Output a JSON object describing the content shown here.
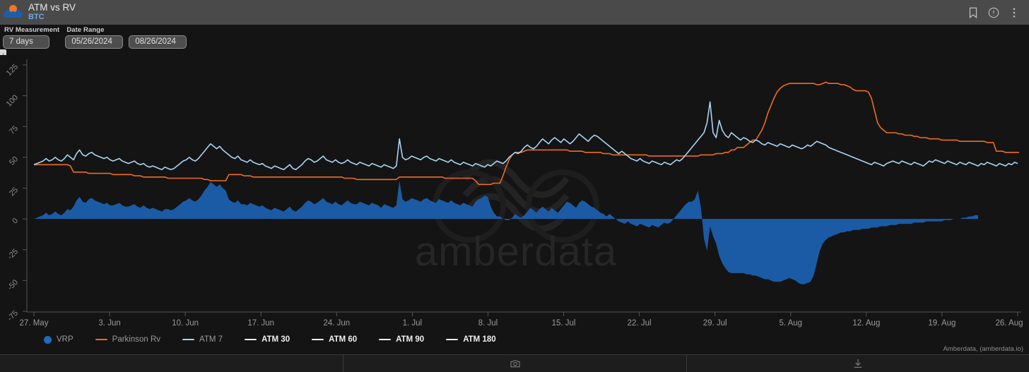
{
  "titlebar": {
    "title": "ATM vs RV",
    "subtitle": "BTC",
    "icons": {
      "bookmark": "bookmark-icon",
      "info": "info-icon",
      "more": "more-vertical-icon"
    }
  },
  "controls": {
    "rv_measurement_label": "RV Measurement",
    "rv_measurement_value": "7 days",
    "date_range_label": "Date Range",
    "date_start_value": "05/26/2024",
    "date_end_value": "08/26/2024",
    "panel_toggle_glyph": "›"
  },
  "legend": [
    {
      "label": "VRP",
      "color": "#1f6bbd",
      "marker": "dot",
      "state": "active"
    },
    {
      "label": "Parkinson Rv",
      "color": "#ef6c21",
      "marker": "line",
      "state": "active"
    },
    {
      "label": "ATM 7",
      "color": "#a8d5f2",
      "marker": "line",
      "state": "active"
    },
    {
      "label": "ATM 30",
      "color": "#f0f0f0",
      "marker": "line",
      "state": "inactive"
    },
    {
      "label": "ATM 60",
      "color": "#f0f0f0",
      "marker": "line",
      "state": "inactive"
    },
    {
      "label": "ATM 90",
      "color": "#f0f0f0",
      "marker": "line",
      "state": "inactive"
    },
    {
      "label": "ATM 180",
      "color": "#f0f0f0",
      "marker": "line",
      "state": "inactive"
    }
  ],
  "attribution": "Amberdata, (amberdata.io)",
  "watermark": "amberdata",
  "bottombar": {
    "camera_icon": "camera-icon",
    "download_icon": "download-icon"
  },
  "chart_data": {
    "type": "line",
    "title": "ATM vs RV",
    "subtitle": "BTC",
    "xlabel": "",
    "ylabel": "",
    "grid": false,
    "legend_position": "bottom-left",
    "ylim": [
      -75,
      125
    ],
    "yticks": [
      125,
      100,
      75,
      50,
      25,
      0,
      -25,
      -50,
      -75
    ],
    "xticks": [
      "27. May",
      "3. Jun",
      "10. Jun",
      "17. Jun",
      "24. Jun",
      "1. Jul",
      "8. Jul",
      "15. Jul",
      "22. Jul",
      "29. Jul",
      "5. Aug",
      "12. Aug",
      "19. Aug",
      "26. Aug"
    ],
    "x_start": "05/26/2024",
    "x_end": "08/26/2024",
    "series": [
      {
        "name": "ATM 7",
        "color": "#a8d5f2",
        "kind": "line",
        "values": [
          44,
          45,
          46,
          47,
          49,
          47,
          48,
          50,
          48,
          47,
          49,
          52,
          50,
          48,
          53,
          56,
          52,
          51,
          53,
          54,
          52,
          51,
          50,
          49,
          50,
          48,
          47,
          48,
          49,
          47,
          46,
          45,
          46,
          47,
          45,
          44,
          45,
          43,
          42,
          43,
          42,
          41,
          40,
          42,
          41,
          40,
          41,
          43,
          45,
          47,
          48,
          50,
          48,
          47,
          49,
          52,
          55,
          58,
          61,
          59,
          57,
          59,
          56,
          54,
          52,
          50,
          49,
          51,
          48,
          47,
          46,
          48,
          46,
          45,
          44,
          45,
          43,
          42,
          41,
          43,
          42,
          41,
          40,
          42,
          44,
          41,
          40,
          42,
          44,
          47,
          49,
          48,
          46,
          47,
          49,
          51,
          48,
          47,
          46,
          48,
          46,
          45,
          46,
          48,
          46,
          45,
          44,
          46,
          45,
          44,
          43,
          45,
          44,
          43,
          42,
          44,
          43,
          42,
          41,
          43,
          65,
          50,
          48,
          49,
          51,
          50,
          49,
          48,
          50,
          51,
          49,
          48,
          47,
          49,
          48,
          47,
          46,
          48,
          46,
          45,
          44,
          46,
          45,
          44,
          43,
          45,
          44,
          43,
          42,
          44,
          43,
          45,
          47,
          46,
          45,
          47,
          50,
          52,
          54,
          53,
          55,
          58,
          60,
          58,
          57,
          59,
          62,
          65,
          63,
          61,
          64,
          66,
          64,
          62,
          65,
          63,
          61,
          63,
          66,
          69,
          67,
          65,
          63,
          66,
          68,
          67,
          65,
          63,
          61,
          59,
          57,
          55,
          53,
          55,
          53,
          51,
          49,
          48,
          47,
          49,
          47,
          46,
          45,
          47,
          46,
          45,
          44,
          46,
          45,
          44,
          46,
          48,
          47,
          49,
          52,
          55,
          58,
          61,
          64,
          67,
          70,
          78,
          95,
          70,
          66,
          80,
          72,
          68,
          66,
          70,
          68,
          66,
          64,
          66,
          65,
          63,
          62,
          64,
          63,
          61,
          60,
          62,
          61,
          60,
          59,
          61,
          60,
          59,
          58,
          60,
          59,
          58,
          57,
          58,
          60,
          59,
          61,
          63,
          62,
          61,
          60,
          58,
          57,
          56,
          55,
          54,
          53,
          52,
          51,
          50,
          49,
          48,
          47,
          46,
          45,
          44,
          46,
          45,
          44,
          43,
          45,
          46,
          47,
          46,
          45,
          47,
          46,
          45,
          44,
          46,
          45,
          44,
          43,
          45,
          47,
          46,
          48,
          47,
          46,
          45,
          47,
          46,
          45,
          44,
          46,
          45,
          44,
          46,
          45,
          44,
          43,
          45,
          44,
          46,
          45,
          44,
          43,
          45,
          44,
          43,
          45,
          44,
          46,
          45
        ]
      },
      {
        "name": "Parkinson Rv",
        "color": "#ef6c21",
        "kind": "line",
        "values": [
          44,
          44,
          44,
          44,
          44,
          44,
          44,
          44,
          44,
          44,
          44,
          44,
          43,
          38,
          38,
          38,
          38,
          38,
          37,
          37,
          37,
          37,
          37,
          37,
          37,
          37,
          36,
          36,
          36,
          36,
          36,
          36,
          36,
          35,
          35,
          35,
          34,
          34,
          34,
          34,
          34,
          34,
          34,
          34,
          33,
          33,
          33,
          33,
          33,
          33,
          33,
          33,
          33,
          33,
          33,
          33,
          32,
          32,
          31,
          31,
          31,
          31,
          31,
          31,
          36,
          36,
          36,
          36,
          36,
          35,
          35,
          35,
          34,
          34,
          34,
          34,
          34,
          34,
          34,
          34,
          34,
          34,
          34,
          34,
          34,
          34,
          34,
          34,
          34,
          34,
          34,
          34,
          34,
          34,
          34,
          34,
          34,
          34,
          34,
          34,
          34,
          34,
          33,
          33,
          33,
          33,
          32,
          32,
          32,
          32,
          32,
          32,
          32,
          32,
          32,
          32,
          32,
          32,
          32,
          32,
          34,
          34,
          34,
          34,
          34,
          34,
          34,
          34,
          34,
          34,
          34,
          34,
          34,
          34,
          34,
          33,
          33,
          33,
          33,
          33,
          33,
          33,
          33,
          33,
          33,
          31,
          28,
          28,
          28,
          28,
          28,
          29,
          29,
          29,
          35,
          42,
          48,
          52,
          54,
          54,
          54,
          55,
          56,
          56,
          56,
          56,
          56,
          56,
          56,
          56,
          56,
          56,
          56,
          56,
          56,
          56,
          55,
          55,
          55,
          55,
          55,
          54,
          54,
          54,
          54,
          54,
          54,
          53,
          53,
          53,
          52,
          52,
          52,
          52,
          52,
          52,
          52,
          52,
          52,
          52,
          52,
          52,
          51,
          51,
          51,
          51,
          51,
          51,
          51,
          51,
          51,
          51,
          51,
          51,
          51,
          51,
          51,
          51,
          51,
          52,
          52,
          52,
          52,
          52,
          53,
          53,
          53,
          54,
          54,
          56,
          56,
          58,
          58,
          58,
          60,
          62,
          64,
          64,
          68,
          72,
          78,
          86,
          92,
          98,
          103,
          106,
          108,
          109,
          110,
          110,
          110,
          110,
          110,
          110,
          110,
          110,
          110,
          109,
          109,
          110,
          111,
          110,
          110,
          110,
          110,
          109,
          109,
          108,
          107,
          105,
          104,
          104,
          104,
          104,
          103,
          98,
          88,
          78,
          74,
          72,
          70,
          70,
          70,
          70,
          69,
          69,
          68,
          68,
          68,
          67,
          67,
          66,
          66,
          66,
          65,
          65,
          65,
          65,
          64,
          64,
          64,
          64,
          64,
          64,
          63,
          63,
          63,
          63,
          63,
          63,
          63,
          63,
          63,
          62,
          62,
          62,
          55,
          55,
          55,
          54,
          54,
          54,
          54,
          54,
          54,
          54,
          54,
          54
        ]
      }
    ],
    "area_series": {
      "name": "VRP",
      "color": "#1f6bbd",
      "kind": "area",
      "description": "Volatility risk premium = ATM IV minus realized vol; positive (above zero) through late July, sharply negative early-to-mid August",
      "values": [
        0,
        1,
        2,
        3,
        5,
        3,
        4,
        6,
        4,
        3,
        5,
        8,
        7,
        10,
        15,
        18,
        14,
        13,
        16,
        17,
        15,
        14,
        13,
        12,
        13,
        11,
        11,
        12,
        13,
        11,
        10,
        10,
        11,
        12,
        10,
        9,
        11,
        9,
        8,
        9,
        8,
        7,
        6,
        8,
        8,
        7,
        8,
        10,
        12,
        14,
        15,
        17,
        15,
        14,
        16,
        19,
        23,
        26,
        30,
        28,
        26,
        28,
        25,
        23,
        16,
        14,
        13,
        15,
        12,
        12,
        11,
        13,
        12,
        11,
        10,
        11,
        9,
        8,
        7,
        9,
        8,
        7,
        6,
        8,
        10,
        7,
        6,
        8,
        10,
        13,
        15,
        14,
        12,
        13,
        15,
        17,
        14,
        13,
        12,
        14,
        12,
        11,
        13,
        15,
        13,
        12,
        12,
        14,
        13,
        12,
        11,
        13,
        12,
        11,
        9,
        12,
        11,
        10,
        9,
        11,
        31,
        16,
        14,
        15,
        17,
        16,
        15,
        14,
        16,
        17,
        15,
        14,
        13,
        16,
        15,
        14,
        13,
        15,
        13,
        12,
        11,
        13,
        12,
        11,
        10,
        14,
        16,
        17,
        19,
        18,
        10,
        5,
        2,
        2,
        0,
        -1,
        -1,
        1,
        4,
        2,
        1,
        3,
        6,
        9,
        7,
        5,
        8,
        10,
        8,
        6,
        9,
        7,
        5,
        8,
        11,
        14,
        13,
        11,
        9,
        13,
        15,
        14,
        12,
        10,
        9,
        7,
        5,
        4,
        2,
        4,
        2,
        0,
        -2,
        -3,
        -4,
        -2,
        -4,
        -5,
        -6,
        -4,
        -5,
        -6,
        -7,
        -5,
        -6,
        -7,
        -5,
        -3,
        -4,
        -3,
        0,
        3,
        6,
        9,
        12,
        14,
        14,
        16,
        23,
        9,
        -16,
        -26,
        -6,
        -14,
        -20,
        -30,
        -36,
        -40,
        -43,
        -44,
        -44,
        -44,
        -44,
        -44,
        -45,
        -45,
        -46,
        -46,
        -47,
        -48,
        -49,
        -49,
        -50,
        -51,
        -51,
        -51,
        -50,
        -49,
        -48,
        -49,
        -50,
        -52,
        -53,
        -53,
        -52,
        -51,
        -46,
        -36,
        -26,
        -20,
        -17,
        -15,
        -14,
        -13,
        -12,
        -11,
        -11,
        -10,
        -10,
        -9,
        -9,
        -9,
        -8,
        -8,
        -8,
        -7,
        -7,
        -7,
        -6,
        -6,
        -6,
        -5,
        -5,
        -5,
        -4,
        -4,
        -4,
        -4,
        -4,
        -3,
        -3,
        -3,
        -3,
        -2,
        -2,
        -2,
        -2,
        -2,
        -2,
        -1,
        -1,
        -1,
        0,
        0,
        0,
        1,
        1,
        2,
        2,
        3,
        3
      ]
    }
  }
}
